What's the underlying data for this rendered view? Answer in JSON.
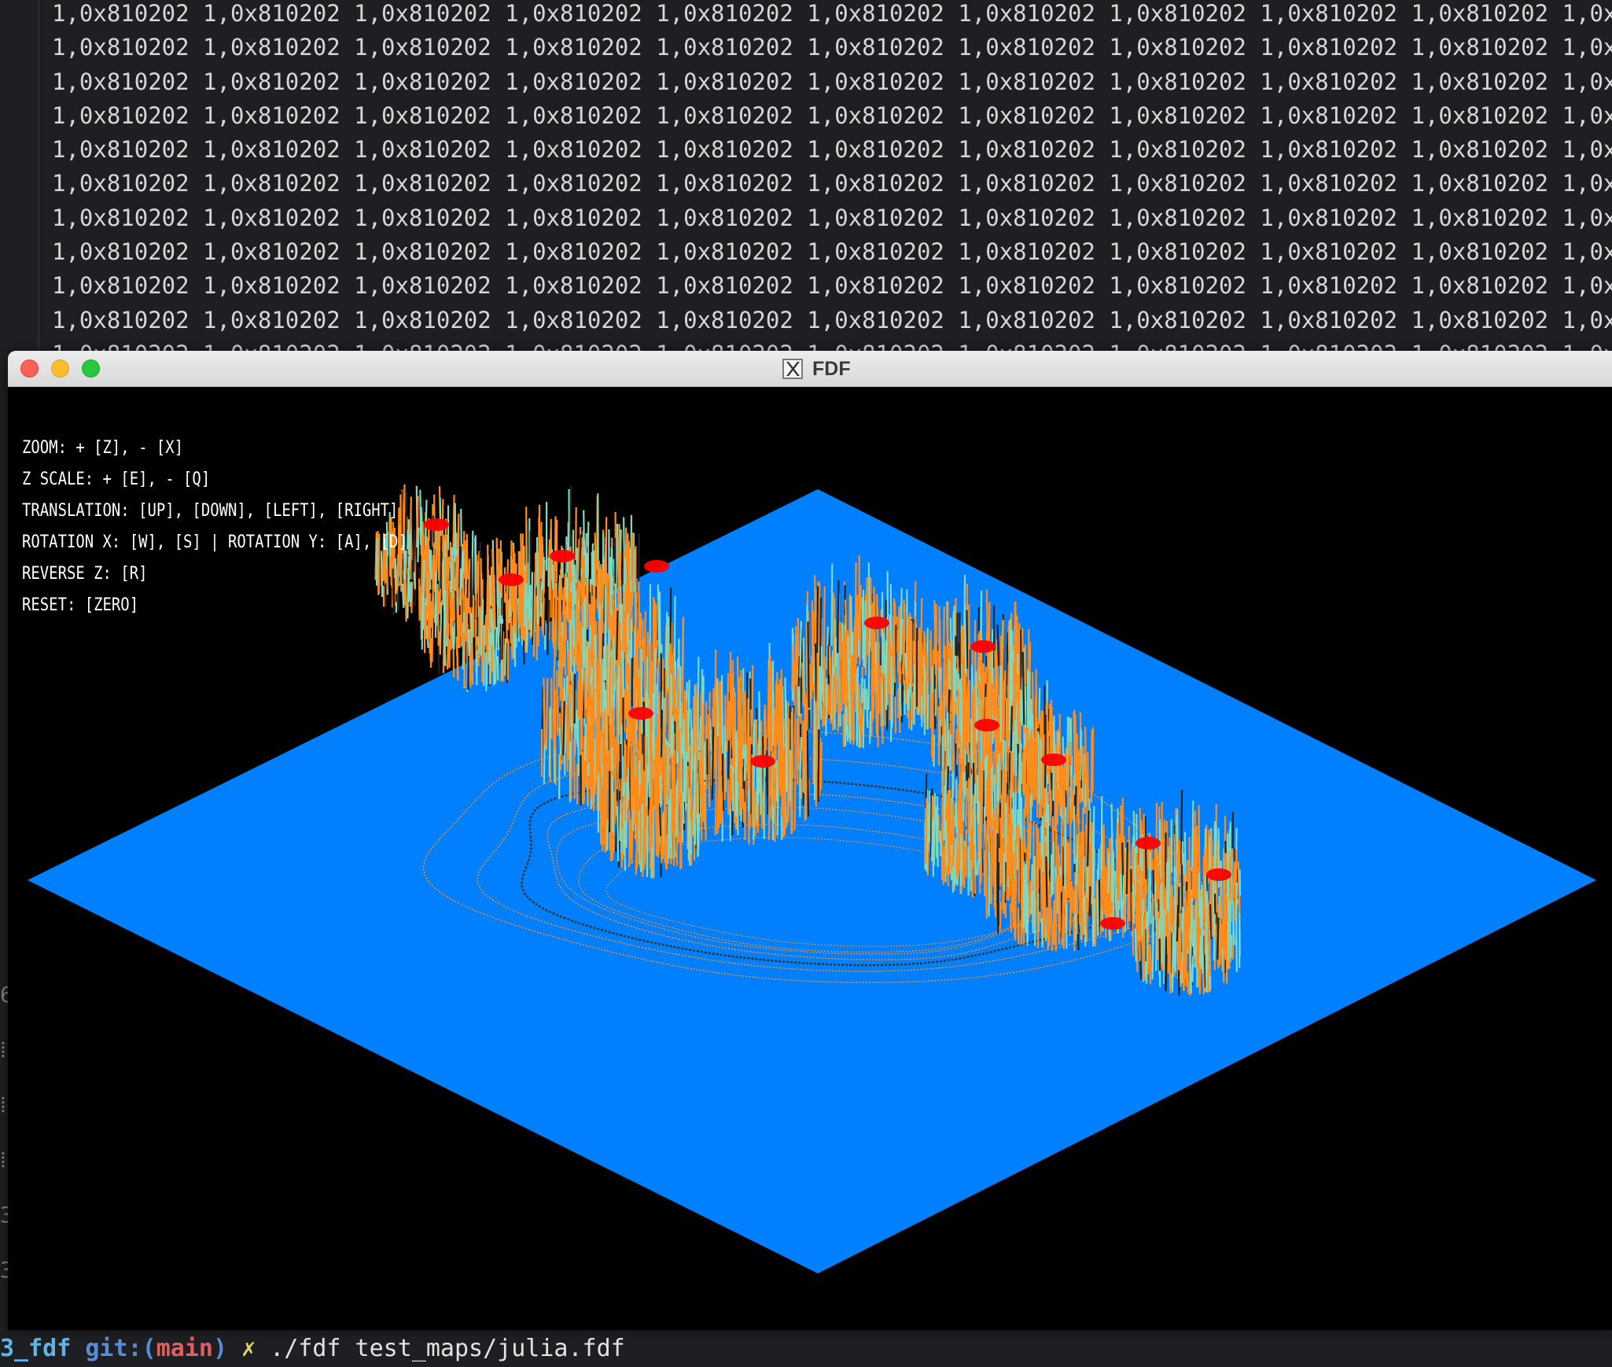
{
  "terminal": {
    "cell_text": "1,0x810202",
    "row_count": 11,
    "left_margin_glyphs": [
      "6",
      "⁞",
      "⁞",
      "⁞",
      "3",
      "3",
      "3"
    ],
    "prompt": {
      "dir": "3_fdf",
      "git_label": "git:",
      "branch_open": "(",
      "branch": "main",
      "branch_close": ")",
      "dirty_mark": "✗",
      "command": "./fdf test_maps/julia.fdf"
    }
  },
  "window": {
    "title": "FDF",
    "title_icon": "x11-icon",
    "buttons": [
      "close",
      "minimize",
      "maximize"
    ]
  },
  "help": {
    "zoom": "ZOOM: + [Z], - [X]",
    "z_scale": "Z SCALE: + [E], - [Q]",
    "translation": "TRANSLATION: [UP], [DOWN], [LEFT], [RIGHT]",
    "rotation": "ROTATION X: [W], [S] | ROTATION Y: [A], [D]",
    "reverse_z": "REVERSE Z: [R]",
    "reset": "RESET: [ZERO]"
  },
  "render": {
    "map_name": "julia",
    "colors": {
      "plane": "#0080ff",
      "contour": "#ff8c1a",
      "peak": "#ff0000",
      "spike_base": "#7fd8c0",
      "background": "#000000"
    }
  }
}
